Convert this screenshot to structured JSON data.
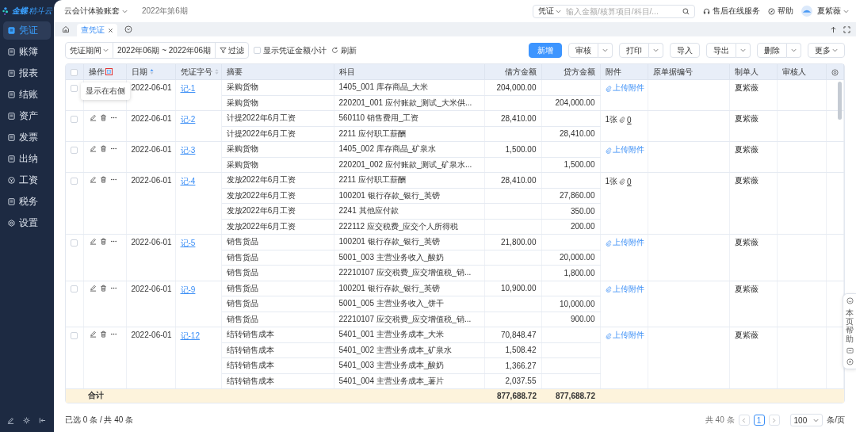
{
  "logo": {
    "brand": "金蝶",
    "product": "精斗云"
  },
  "sidebar": {
    "items": [
      {
        "label": "凭证",
        "selected": true
      },
      {
        "label": "账簿",
        "selected": false
      },
      {
        "label": "报表",
        "selected": false
      },
      {
        "label": "结账",
        "selected": false
      },
      {
        "label": "资产",
        "selected": false
      },
      {
        "label": "发票",
        "selected": false
      },
      {
        "label": "出纳",
        "selected": false
      },
      {
        "label": "工资",
        "selected": false
      },
      {
        "label": "税务",
        "selected": false
      },
      {
        "label": "设置",
        "selected": false
      }
    ]
  },
  "header": {
    "account": "云会计体验账套",
    "period": "2022年第6期",
    "search_type": "凭证",
    "search_placeholder": "输入金额/核算项目/科目/...",
    "service": "售后在线服务",
    "help": "帮助",
    "user": "夏紫薇"
  },
  "tabs": [
    {
      "label": "查凭证",
      "selected": true
    }
  ],
  "toolbar": {
    "period_type": "凭证期间",
    "range": "2022年06期 ~ 2022年06期",
    "filter": "过滤",
    "subtotal": {
      "label": "显示凭证金额小计",
      "checked": false
    },
    "refresh": "刷新",
    "buttons": [
      {
        "label": "新增",
        "kind": "primary"
      },
      {
        "label": "审核",
        "kind": "split"
      },
      {
        "label": "打印",
        "kind": "split"
      },
      {
        "label": "导入",
        "kind": "plain"
      },
      {
        "label": "导出",
        "kind": "split"
      },
      {
        "label": "删除",
        "kind": "split"
      },
      {
        "label": "更多",
        "kind": "dropdown"
      }
    ]
  },
  "table": {
    "all_checked": false,
    "columns": [
      {
        "label": "操作"
      },
      {
        "label": "日期",
        "sorted": true
      },
      {
        "label": "凭证字号",
        "sorted": false
      },
      {
        "label": "摘要"
      },
      {
        "label": "科目"
      },
      {
        "label": "借方金额"
      },
      {
        "label": "贷方金额"
      },
      {
        "label": "附件"
      },
      {
        "label": "原单据编号"
      },
      {
        "label": "制单人"
      },
      {
        "label": "审核人"
      }
    ],
    "tooltip": "显示在右侧",
    "vouchers": [
      {
        "checked": false,
        "date": "2022-06-01",
        "number": "记-1",
        "attachment": {
          "kind": "upload",
          "label": "上传附件"
        },
        "maker": "夏紫薇",
        "entries": [
          {
            "summary": "采购货物",
            "account": "1405_001 库存商品_大米",
            "debit": "204,000.00"
          },
          {
            "summary": "采购货物",
            "account": "220201_001 应付账款_测试_大米供...",
            "credit": "204,000.00"
          }
        ]
      },
      {
        "checked": false,
        "date": "2022-06-01",
        "number": "记-2",
        "attachment": {
          "kind": "count",
          "count": "1张",
          "link": "0"
        },
        "maker": "夏紫薇",
        "entries": [
          {
            "summary": "计提2022年6月工资",
            "account": "560110 销售费用_工资",
            "debit": "28,410.00"
          },
          {
            "summary": "计提2022年6月工资",
            "account": "2211 应付职工薪酬",
            "credit": "28,410.00"
          }
        ]
      },
      {
        "checked": false,
        "date": "2022-06-01",
        "number": "记-3",
        "attachment": {
          "kind": "upload",
          "label": "上传附件"
        },
        "maker": "夏紫薇",
        "entries": [
          {
            "summary": "采购货物",
            "account": "1405_002 库存商品_矿泉水",
            "debit": "1,500.00"
          },
          {
            "summary": "采购货物",
            "account": "220201_002 应付账款_测试_矿泉水...",
            "credit": "1,500.00"
          }
        ]
      },
      {
        "checked": false,
        "date": "2022-06-01",
        "number": "记-4",
        "attachment": {
          "kind": "count",
          "count": "1张",
          "link": "0"
        },
        "maker": "夏紫薇",
        "entries": [
          {
            "summary": "发放2022年6月工资",
            "account": "2211 应付职工薪酬",
            "debit": "28,410.00"
          },
          {
            "summary": "发放2022年6月工资",
            "account": "100201 银行存款_银行_英镑",
            "credit": "27,860.00"
          },
          {
            "summary": "发放2022年6月工资",
            "account": "2241 其他应付款",
            "credit": "350.00"
          },
          {
            "summary": "发放2022年6月工资",
            "account": "222112 应交税费_应交个人所得税",
            "credit": "200.00"
          }
        ]
      },
      {
        "checked": false,
        "date": "2022-06-01",
        "number": "记-5",
        "attachment": {
          "kind": "upload",
          "label": "上传附件"
        },
        "maker": "夏紫薇",
        "entries": [
          {
            "summary": "销售货品",
            "account": "100201 银行存款_银行_英镑",
            "debit": "21,800.00"
          },
          {
            "summary": "销售货品",
            "account": "5001_003 主营业务收入_酸奶",
            "credit": "20,000.00"
          },
          {
            "summary": "销售货品",
            "account": "22210107 应交税费_应交增值税_销...",
            "credit": "1,800.00"
          }
        ]
      },
      {
        "checked": false,
        "date": "2022-06-01",
        "number": "记-9",
        "attachment": {
          "kind": "upload",
          "label": "上传附件"
        },
        "maker": "夏紫薇",
        "entries": [
          {
            "summary": "销售货品",
            "account": "100201 银行存款_银行_英镑",
            "debit": "10,900.00"
          },
          {
            "summary": "销售货品",
            "account": "5001_005 主营业务收入_饼干",
            "credit": "10,000.00"
          },
          {
            "summary": "销售货品",
            "account": "22210107 应交税费_应交增值税_销...",
            "credit": "900.00"
          }
        ]
      },
      {
        "checked": false,
        "date": "2022-06-01",
        "number": "记-12",
        "attachment": {
          "kind": "upload",
          "label": "上传附件"
        },
        "maker": "夏紫薇",
        "entries": [
          {
            "summary": "结转销售成本",
            "account": "5401_001 主营业务成本_大米",
            "debit": "70,848.47"
          },
          {
            "summary": "结转销售成本",
            "account": "5401_002 主营业务成本_矿泉水",
            "debit": "1,508.42"
          },
          {
            "summary": "结转销售成本",
            "account": "5401_003 主营业务成本_酸奶",
            "debit": "1,366.27"
          },
          {
            "summary": "结转销售成本",
            "account": "5401_004 主营业务成本_薯片",
            "debit": "2,037.55"
          }
        ]
      }
    ],
    "total": {
      "label": "合计",
      "debit": "877,688.72",
      "credit": "877,688.72"
    }
  },
  "footer": {
    "selection": "已选 0 条 / 共 40 条",
    "count": "共 40 条",
    "pages": [
      {
        "label": "1",
        "selected": true
      }
    ],
    "page_size": "100",
    "per_page": "条/页"
  },
  "help_widget": {
    "label": "本页帮助"
  }
}
